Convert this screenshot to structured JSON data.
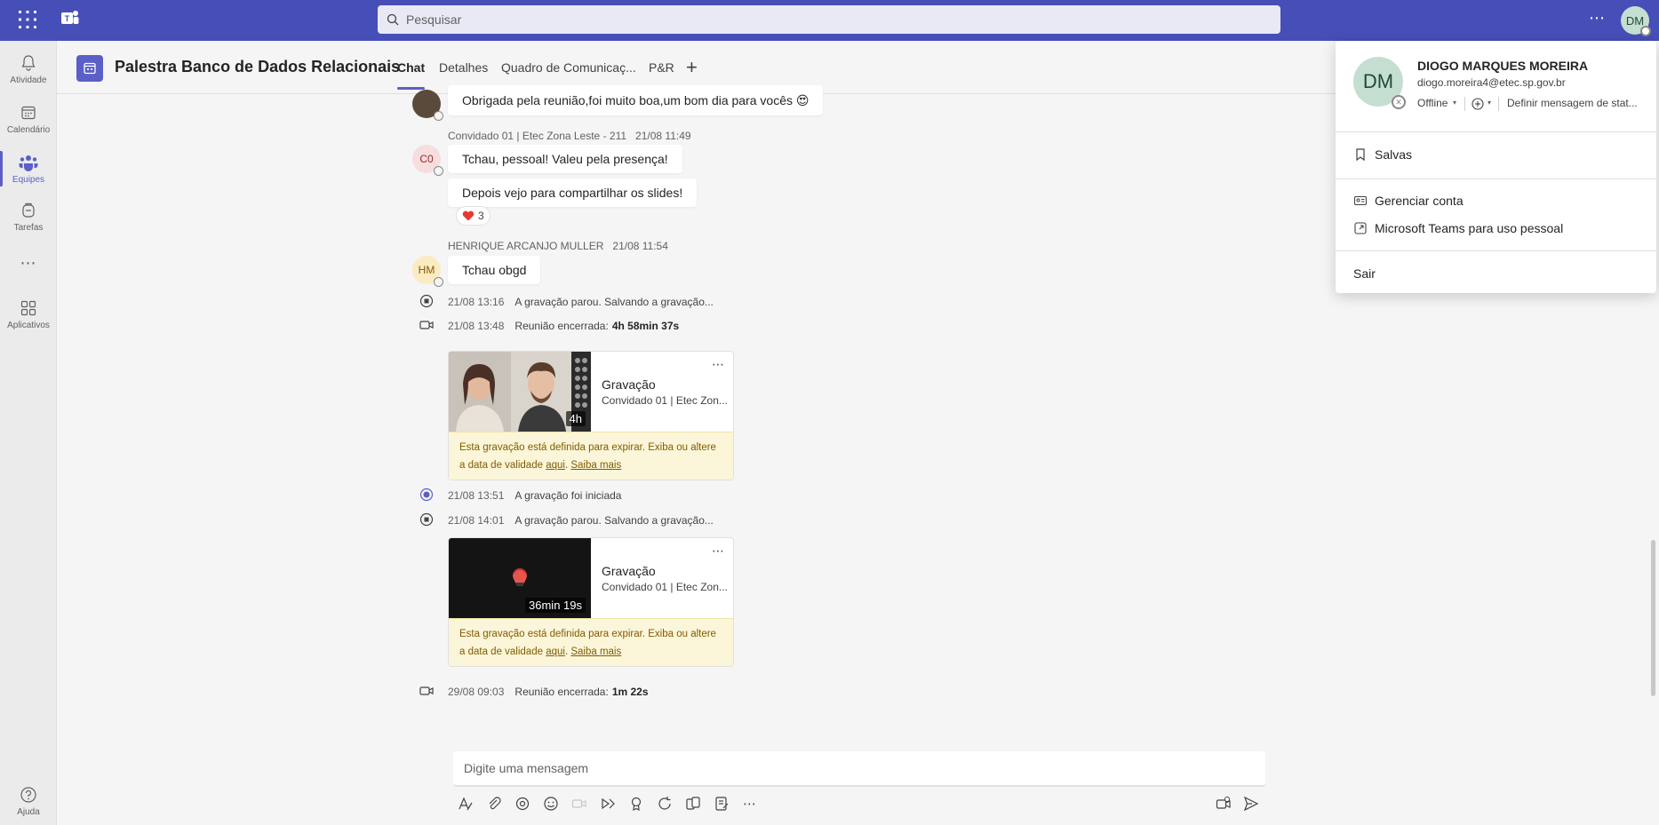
{
  "topbar": {
    "search_placeholder": "Pesquisar",
    "more": "⋯",
    "user_initials": "DM"
  },
  "rail": [
    {
      "label": "Atividade",
      "icon": "bell-icon"
    },
    {
      "label": "Calendário",
      "icon": "calendar-icon"
    },
    {
      "label": "Equipes",
      "icon": "teams-icon",
      "active": true
    },
    {
      "label": "Tarefas",
      "icon": "tasks-icon"
    },
    {
      "label": "⋯",
      "icon": "more-icon"
    },
    {
      "label": "Aplicativos",
      "icon": "apps-icon"
    },
    {
      "label": "Ajuda",
      "icon": "help-icon"
    }
  ],
  "channel": {
    "title": "Palestra Banco de Dados Relacionais",
    "tabs": [
      "Chat",
      "Detalhes",
      "Quadro de Comunicaç...",
      "P&R"
    ],
    "add": "+"
  },
  "messages": {
    "m1_text": "Obrigada pela reunião,foi muito boa,um bom dia para vocês 😍",
    "m2_author": "Convidado 01 | Etec Zona Leste - 211",
    "m2_time": "21/08 11:49",
    "m2_initials": "C0",
    "m2_text1": "Tchau, pessoal! Valeu pela presença!",
    "m2_text2": "Depois vejo para compartilhar os slides!",
    "m2_reaction_count": "3",
    "m3_author": "HENRIQUE ARCANJO MULLER",
    "m3_time": "21/08 11:54",
    "m3_initials": "HM",
    "m3_text": "Tchau obgd"
  },
  "system": [
    {
      "time": "21/08 13:16",
      "text": "A gravação parou. Salvando a gravação...",
      "bold": ""
    },
    {
      "time": "21/08 13:48",
      "text": "Reunião encerrada:",
      "bold": "4h 58min 37s"
    },
    {
      "time": "21/08 13:51",
      "text": "A gravação foi iniciada",
      "bold": ""
    },
    {
      "time": "21/08 14:01",
      "text": "A gravação parou. Salvando a gravação...",
      "bold": ""
    },
    {
      "time": "29/08 09:03",
      "text": "Reunião encerrada:",
      "bold": "1m 22s"
    }
  ],
  "recordings": [
    {
      "duration": "4h",
      "title": "Gravação",
      "subtitle": "Convidado 01 | Etec Zon...",
      "warn1": "Esta gravação está definida para expirar. Exiba ou altere",
      "warn2": "a data de validade",
      "link1": "aqui",
      "link2": "Saiba mais"
    },
    {
      "duration": "36min 19s",
      "title": "Gravação",
      "subtitle": "Convidado 01 | Etec Zon...",
      "warn1": "Esta gravação está definida para expirar. Exiba ou altere",
      "warn2": "a data de validade",
      "link1": "aqui",
      "link2": "Saiba mais"
    }
  ],
  "composer": {
    "placeholder": "Digite uma mensagem"
  },
  "profile": {
    "initials": "DM",
    "name": "DIOGO MARQUES MOREIRA",
    "email": "diogo.moreira4@etec.sp.gov.br",
    "status": "Offline",
    "set_message": "Definir mensagem de stat...",
    "saved": "Salvas",
    "manage": "Gerenciar conta",
    "personal": "Microsoft Teams para uso pessoal",
    "signout": "Sair"
  },
  "colors": {
    "brand": "#464eb8",
    "accent": "#5b5fc7",
    "warning_bg": "#fbf6d9",
    "reaction_heart": "#e53935"
  }
}
